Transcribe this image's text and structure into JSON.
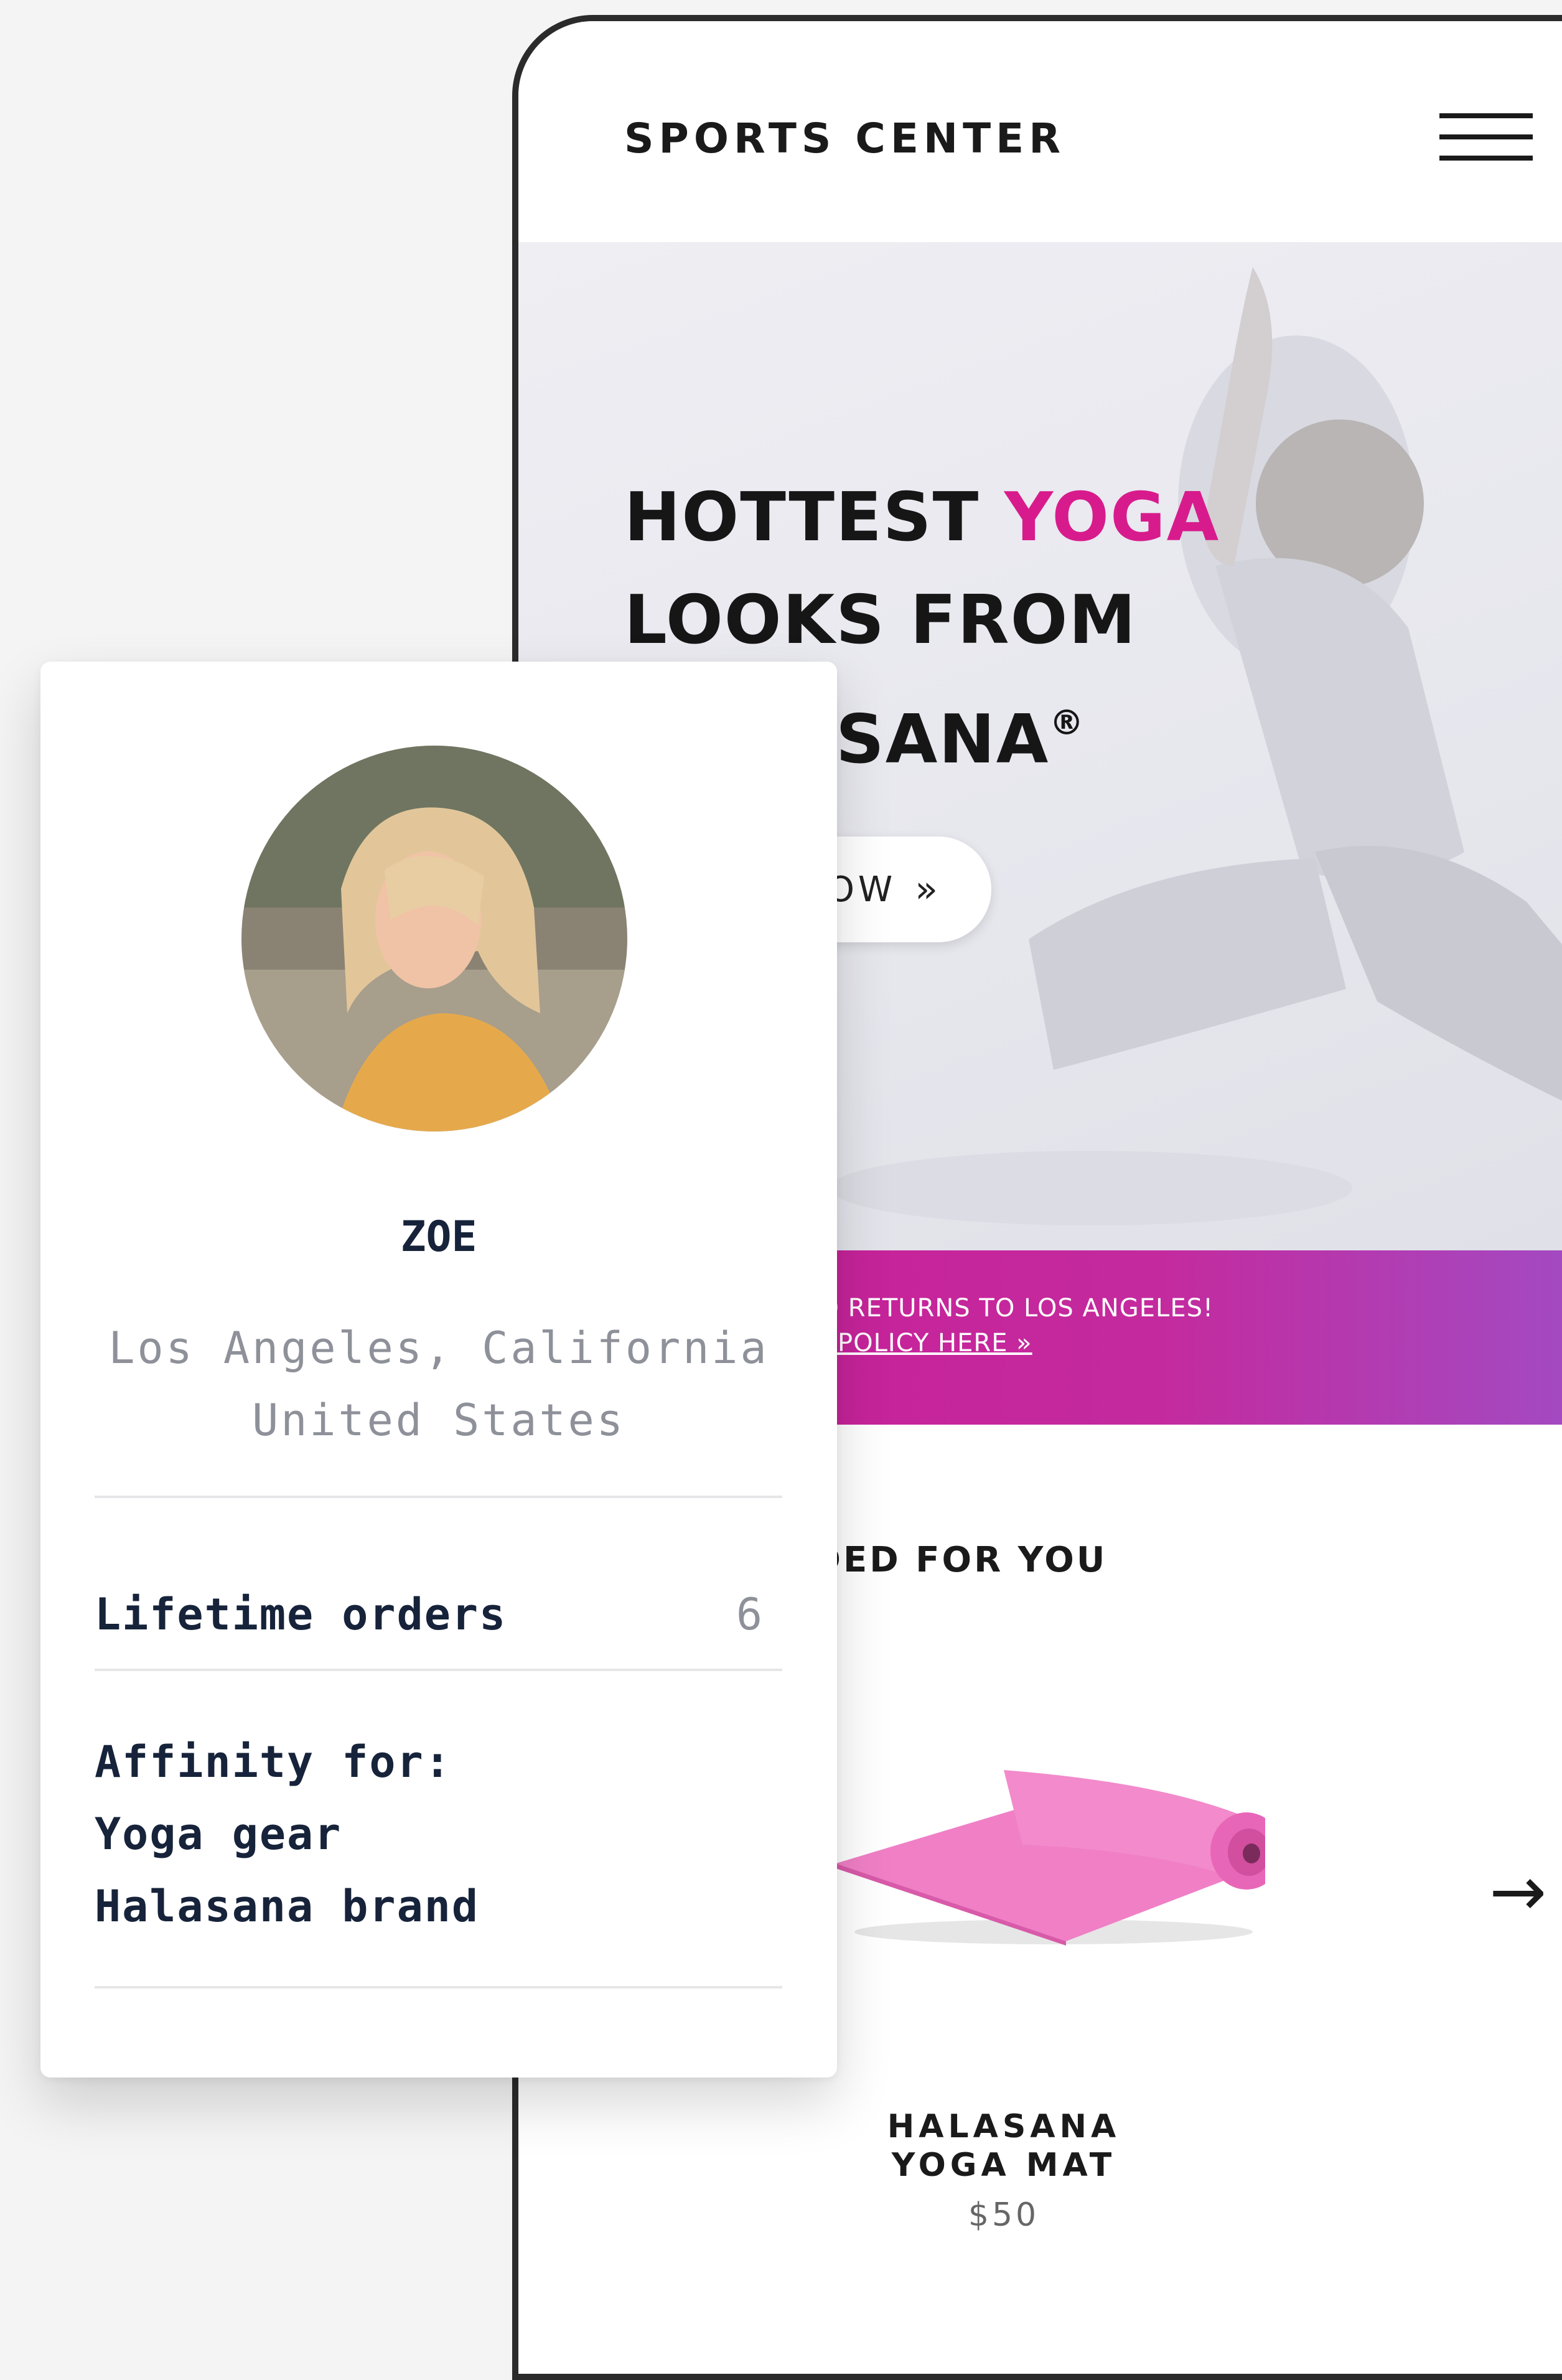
{
  "app": {
    "brand": "SPORTS CENTER",
    "menu_icon": "hamburger-menu-icon"
  },
  "hero": {
    "headline_part1": "HOTTEST ",
    "headline_accent": "YOGA",
    "headline_line2": "LOOKS FROM",
    "headline_line3": "SANA",
    "registered_mark": "®",
    "button_label": "NOW",
    "button_icon": "double-chevron-right-icon",
    "accent_color": "#d81b8c"
  },
  "promo": {
    "line1": "REE SHIPPING AND RETURNS TO LOS ANGELES!",
    "line2": "ON OUR RETURNS POLICY HERE »"
  },
  "recommended": {
    "heading": "ECOMMENDED FOR YOU",
    "next_icon": "arrow-right-icon",
    "product": {
      "name_line1": "HALASANA",
      "name_line2": "YOGA MAT",
      "price": "$50"
    }
  },
  "profile": {
    "name": "ZOE",
    "location_line1": "Los Angeles, California",
    "location_line2": "United States",
    "lifetime_orders_label": "Lifetime orders",
    "lifetime_orders_value": "6",
    "affinity_title": "Affinity for:",
    "affinities": [
      "Yoga gear",
      "Halasana brand"
    ]
  }
}
